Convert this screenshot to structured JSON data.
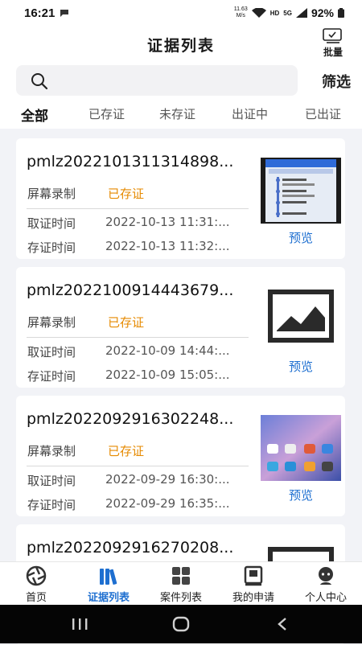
{
  "status_bar": {
    "time": "16:21",
    "speed_top": "11.63",
    "speed_bottom": "M/s",
    "hd": "HD",
    "network": "5G",
    "battery": "92%"
  },
  "header": {
    "title": "证据列表",
    "batch_label": "批量"
  },
  "search": {
    "placeholder": "",
    "value": "",
    "filter_label": "筛选"
  },
  "tabs": [
    {
      "label": "全部",
      "active": true
    },
    {
      "label": "已存证",
      "active": false
    },
    {
      "label": "未存证",
      "active": false
    },
    {
      "label": "出证中",
      "active": false
    },
    {
      "label": "已出证",
      "active": false
    }
  ],
  "field_labels": {
    "capture_time": "取证时间",
    "store_time": "存证时间",
    "preview": "预览"
  },
  "cards": [
    {
      "title": "pmlz2022101311314898...",
      "type": "屏幕录制",
      "status": "已存证",
      "capture_time": "2022-10-13 11:31:...",
      "store_time": "2022-10-13 11:32:..."
    },
    {
      "title": "pmlz2022100914443679...",
      "type": "屏幕录制",
      "status": "已存证",
      "capture_time": "2022-10-09 14:44:...",
      "store_time": "2022-10-09 15:05:..."
    },
    {
      "title": "pmlz2022092916302248...",
      "type": "屏幕录制",
      "status": "已存证",
      "capture_time": "2022-09-29 16:30:...",
      "store_time": "2022-09-29 16:35:..."
    },
    {
      "title": "pmlz2022092916270208...",
      "type": "",
      "status": "",
      "capture_time": "",
      "store_time": ""
    }
  ],
  "bottom_nav": [
    {
      "label": "首页",
      "icon": "shutter-icon",
      "active": false
    },
    {
      "label": "证据列表",
      "icon": "books-icon",
      "active": true
    },
    {
      "label": "案件列表",
      "icon": "grid-icon",
      "active": false
    },
    {
      "label": "我的申请",
      "icon": "album-icon",
      "active": false
    },
    {
      "label": "个人中心",
      "icon": "user-icon",
      "active": false
    }
  ],
  "colors": {
    "accent": "#1e6fd0",
    "status": "#e68a00"
  }
}
